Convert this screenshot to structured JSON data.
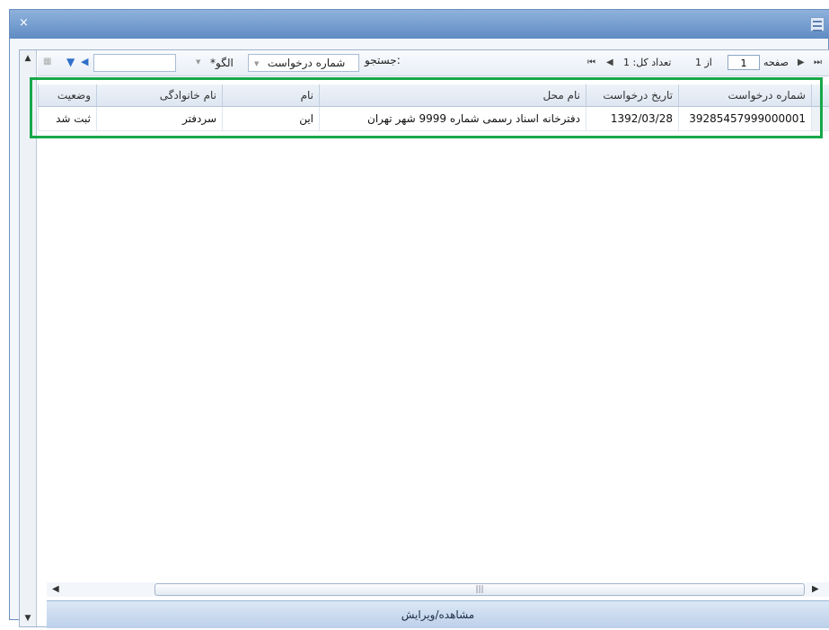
{
  "window": {
    "close_label": "×"
  },
  "toolbar": {
    "page_label": "صفحه",
    "page_value": "1",
    "of_label": "از 1",
    "total_label": "تعداد کل: 1",
    "search_label": "جستجو:",
    "search_field_value": "شماره درخواست",
    "pattern_value": "*الگو",
    "search_input_value": ""
  },
  "table": {
    "headers": [
      "شماره درخواست",
      "تاریخ درخواست",
      "نام محل",
      "نام",
      "نام خانوادگی",
      "وضعیت"
    ],
    "rows": [
      [
        "39285457999000001",
        "1392/03/28",
        "دفترخانه اسناد رسمی شماره 9999 شهر تهران",
        "این",
        "سردفتر",
        "ثبت شد"
      ]
    ]
  },
  "footer": {
    "view_edit_label": "مشاهده/ویرایش"
  },
  "colors": {
    "highlight": "#17a84a",
    "titlebar": "#6f98cc"
  }
}
